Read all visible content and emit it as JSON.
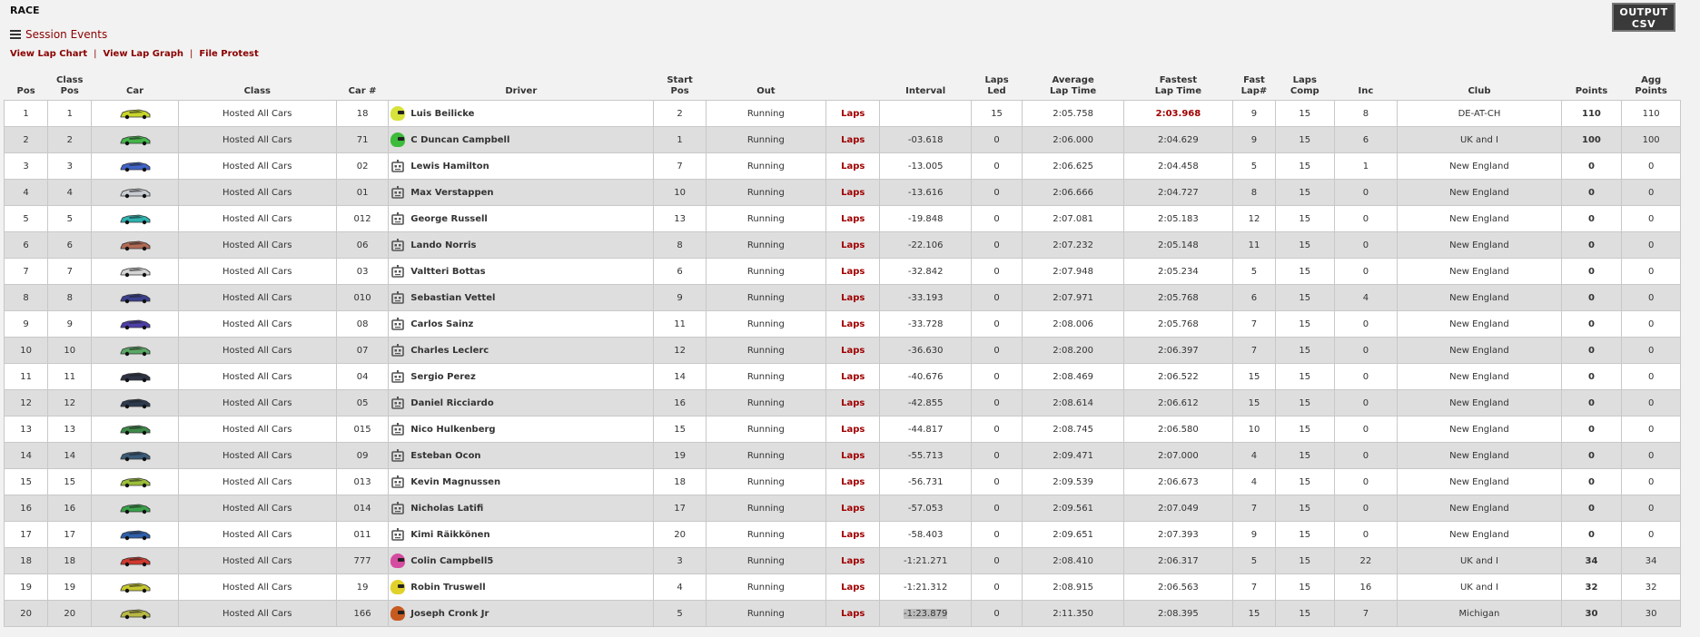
{
  "header": {
    "race_title": "RACE",
    "session_events": "Session Events",
    "links": [
      "View Lap Chart",
      "View Lap Graph",
      "File Protest"
    ],
    "output_csv": [
      "OUTPUT",
      "CSV"
    ]
  },
  "columns": [
    "Pos",
    "Class Pos",
    "Car",
    "Class",
    "Car #",
    "Driver",
    "Start Pos",
    "Out",
    "",
    "Interval",
    "Laps Led",
    "Average Lap Time",
    "Fastest Lap Time",
    "Fast Lap#",
    "Laps Comp",
    "Inc",
    "Club",
    "Points",
    "Agg Points"
  ],
  "column_headers": {
    "pos": "Pos",
    "class_pos": "Class Pos",
    "car": "Car",
    "class": "Class",
    "car_num": "Car #",
    "driver": "Driver",
    "start_pos_1": "Start",
    "start_pos_2": "Pos",
    "out": "Out",
    "interval": "Interval",
    "laps_led_1": "Laps",
    "laps_led_2": "Led",
    "avg_1": "Average",
    "avg_2": "Lap Time",
    "fast_1": "Fastest",
    "fast_2": "Lap Time",
    "fastnum_1": "Fast",
    "fastnum_2": "Lap#",
    "lapscomp_1": "Laps",
    "lapscomp_2": "Comp",
    "inc": "Inc",
    "club": "Club",
    "points": "Points",
    "agg_1": "Agg",
    "agg_2": "Points"
  },
  "laps_link_label": "Laps",
  "rows": [
    {
      "pos": "1",
      "class_pos": "1",
      "car_color": "#c9d62a",
      "class": "Hosted All Cars",
      "car_num": "18",
      "driver": "Luis Beilicke",
      "helmet": "#d7e23a",
      "start": "2",
      "out": "Running",
      "interval": "",
      "laps_led": "15",
      "avg": "2:05.758",
      "fast": "2:03.968",
      "fast_red": true,
      "fast_lap": "9",
      "laps_comp": "15",
      "inc": "8",
      "club": "DE-AT-CH",
      "points": "110",
      "agg": "110"
    },
    {
      "pos": "2",
      "class_pos": "2",
      "car_color": "#45b54a",
      "class": "Hosted All Cars",
      "car_num": "71",
      "driver": "C Duncan Campbell",
      "helmet": "#3dbb3a",
      "start": "1",
      "out": "Running",
      "interval": "-03.618",
      "laps_led": "0",
      "avg": "2:06.000",
      "fast": "2:04.629",
      "fast_lap": "9",
      "laps_comp": "15",
      "inc": "6",
      "club": "UK and I",
      "points": "100",
      "agg": "100"
    },
    {
      "pos": "3",
      "class_pos": "3",
      "car_color": "#3f63c7",
      "class": "Hosted All Cars",
      "car_num": "02",
      "driver": "Lewis Hamilton",
      "start": "7",
      "out": "Running",
      "interval": "-13.005",
      "laps_led": "0",
      "avg": "2:06.625",
      "fast": "2:04.458",
      "fast_lap": "5",
      "laps_comp": "15",
      "inc": "1",
      "club": "New England",
      "points": "0",
      "agg": "0"
    },
    {
      "pos": "4",
      "class_pos": "4",
      "car_color": "#c9cdd3",
      "class": "Hosted All Cars",
      "car_num": "01",
      "driver": "Max Verstappen",
      "start": "10",
      "out": "Running",
      "interval": "-13.616",
      "laps_led": "0",
      "avg": "2:06.666",
      "fast": "2:04.727",
      "fast_lap": "8",
      "laps_comp": "15",
      "inc": "0",
      "club": "New England",
      "points": "0",
      "agg": "0"
    },
    {
      "pos": "5",
      "class_pos": "5",
      "car_color": "#2eb3b0",
      "class": "Hosted All Cars",
      "car_num": "012",
      "driver": "George Russell",
      "start": "13",
      "out": "Running",
      "interval": "-19.848",
      "laps_led": "0",
      "avg": "2:07.081",
      "fast": "2:05.183",
      "fast_lap": "12",
      "laps_comp": "15",
      "inc": "0",
      "club": "New England",
      "points": "0",
      "agg": "0"
    },
    {
      "pos": "6",
      "class_pos": "6",
      "car_color": "#b06a55",
      "class": "Hosted All Cars",
      "car_num": "06",
      "driver": "Lando Norris",
      "start": "8",
      "out": "Running",
      "interval": "-22.106",
      "laps_led": "0",
      "avg": "2:07.232",
      "fast": "2:05.148",
      "fast_lap": "11",
      "laps_comp": "15",
      "inc": "0",
      "club": "New England",
      "points": "0",
      "agg": "0"
    },
    {
      "pos": "7",
      "class_pos": "7",
      "car_color": "#d4d4d4",
      "class": "Hosted All Cars",
      "car_num": "03",
      "driver": "Valtteri Bottas",
      "start": "6",
      "out": "Running",
      "interval": "-32.842",
      "laps_led": "0",
      "avg": "2:07.948",
      "fast": "2:05.234",
      "fast_lap": "5",
      "laps_comp": "15",
      "inc": "0",
      "club": "New England",
      "points": "0",
      "agg": "0"
    },
    {
      "pos": "8",
      "class_pos": "8",
      "car_color": "#3a3f8c",
      "class": "Hosted All Cars",
      "car_num": "010",
      "driver": "Sebastian Vettel",
      "start": "9",
      "out": "Running",
      "interval": "-33.193",
      "laps_led": "0",
      "avg": "2:07.971",
      "fast": "2:05.768",
      "fast_lap": "6",
      "laps_comp": "15",
      "inc": "4",
      "club": "New England",
      "points": "0",
      "agg": "0"
    },
    {
      "pos": "9",
      "class_pos": "9",
      "car_color": "#4d3fa8",
      "class": "Hosted All Cars",
      "car_num": "08",
      "driver": "Carlos Sainz",
      "start": "11",
      "out": "Running",
      "interval": "-33.728",
      "laps_led": "0",
      "avg": "2:08.006",
      "fast": "2:05.768",
      "fast_lap": "7",
      "laps_comp": "15",
      "inc": "0",
      "club": "New England",
      "points": "0",
      "agg": "0"
    },
    {
      "pos": "10",
      "class_pos": "10",
      "car_color": "#5aa865",
      "class": "Hosted All Cars",
      "car_num": "07",
      "driver": "Charles Leclerc",
      "start": "12",
      "out": "Running",
      "interval": "-36.630",
      "laps_led": "0",
      "avg": "2:08.200",
      "fast": "2:06.397",
      "fast_lap": "7",
      "laps_comp": "15",
      "inc": "0",
      "club": "New England",
      "points": "0",
      "agg": "0"
    },
    {
      "pos": "11",
      "class_pos": "11",
      "car_color": "#2e3444",
      "class": "Hosted All Cars",
      "car_num": "04",
      "driver": "Sergio Perez",
      "start": "14",
      "out": "Running",
      "interval": "-40.676",
      "laps_led": "0",
      "avg": "2:08.469",
      "fast": "2:06.522",
      "fast_lap": "15",
      "laps_comp": "15",
      "inc": "0",
      "club": "New England",
      "points": "0",
      "agg": "0"
    },
    {
      "pos": "12",
      "class_pos": "12",
      "car_color": "#2d3a4e",
      "class": "Hosted All Cars",
      "car_num": "05",
      "driver": "Daniel Ricciardo",
      "start": "16",
      "out": "Running",
      "interval": "-42.855",
      "laps_led": "0",
      "avg": "2:08.614",
      "fast": "2:06.612",
      "fast_lap": "15",
      "laps_comp": "15",
      "inc": "0",
      "club": "New England",
      "points": "0",
      "agg": "0"
    },
    {
      "pos": "13",
      "class_pos": "13",
      "car_color": "#3f8a4a",
      "class": "Hosted All Cars",
      "car_num": "015",
      "driver": "Nico Hulkenberg",
      "start": "15",
      "out": "Running",
      "interval": "-44.817",
      "laps_led": "0",
      "avg": "2:08.745",
      "fast": "2:06.580",
      "fast_lap": "10",
      "laps_comp": "15",
      "inc": "0",
      "club": "New England",
      "points": "0",
      "agg": "0"
    },
    {
      "pos": "14",
      "class_pos": "14",
      "car_color": "#3b5a78",
      "class": "Hosted All Cars",
      "car_num": "09",
      "driver": "Esteban Ocon",
      "start": "19",
      "out": "Running",
      "interval": "-55.713",
      "laps_led": "0",
      "avg": "2:09.471",
      "fast": "2:07.000",
      "fast_lap": "4",
      "laps_comp": "15",
      "inc": "0",
      "club": "New England",
      "points": "0",
      "agg": "0"
    },
    {
      "pos": "15",
      "class_pos": "15",
      "car_color": "#9bbf3a",
      "class": "Hosted All Cars",
      "car_num": "013",
      "driver": "Kevin Magnussen",
      "start": "18",
      "out": "Running",
      "interval": "-56.731",
      "laps_led": "0",
      "avg": "2:09.539",
      "fast": "2:06.673",
      "fast_lap": "4",
      "laps_comp": "15",
      "inc": "0",
      "club": "New England",
      "points": "0",
      "agg": "0"
    },
    {
      "pos": "16",
      "class_pos": "16",
      "car_color": "#3aa24a",
      "class": "Hosted All Cars",
      "car_num": "014",
      "driver": "Nicholas Latifi",
      "start": "17",
      "out": "Running",
      "interval": "-57.053",
      "laps_led": "0",
      "avg": "2:09.561",
      "fast": "2:07.049",
      "fast_lap": "7",
      "laps_comp": "15",
      "inc": "0",
      "club": "New England",
      "points": "0",
      "agg": "0"
    },
    {
      "pos": "17",
      "class_pos": "17",
      "car_color": "#2f5fa8",
      "class": "Hosted All Cars",
      "car_num": "011",
      "driver": "Kimi Räikkönen",
      "start": "20",
      "out": "Running",
      "interval": "-58.403",
      "laps_led": "0",
      "avg": "2:09.651",
      "fast": "2:07.393",
      "fast_lap": "9",
      "laps_comp": "15",
      "inc": "0",
      "club": "New England",
      "points": "0",
      "agg": "0"
    },
    {
      "pos": "18",
      "class_pos": "18",
      "car_color": "#d03a2e",
      "class": "Hosted All Cars",
      "car_num": "777",
      "driver": "Colin Campbell5",
      "helmet": "#d44ba0",
      "start": "3",
      "out": "Running",
      "interval": "-1:21.271",
      "laps_led": "0",
      "avg": "2:08.410",
      "fast": "2:06.317",
      "fast_lap": "5",
      "laps_comp": "15",
      "inc": "22",
      "club": "UK and I",
      "points": "34",
      "agg": "34"
    },
    {
      "pos": "19",
      "class_pos": "19",
      "car_color": "#c7c832",
      "class": "Hosted All Cars",
      "car_num": "19",
      "driver": "Robin Truswell",
      "helmet": "#e0d22a",
      "start": "4",
      "out": "Running",
      "interval": "-1:21.312",
      "laps_led": "0",
      "avg": "2:08.915",
      "fast": "2:06.563",
      "fast_lap": "7",
      "laps_comp": "15",
      "inc": "16",
      "club": "UK and I",
      "points": "32",
      "agg": "32"
    },
    {
      "pos": "20",
      "class_pos": "20",
      "car_color": "#b8b845",
      "class": "Hosted All Cars",
      "car_num": "166",
      "driver": "Joseph Cronk Jr",
      "helmet": "#c75a1f",
      "start": "5",
      "out": "Running",
      "interval": "-1:23.879",
      "interval_hl": true,
      "laps_led": "0",
      "avg": "2:11.350",
      "fast": "2:08.395",
      "fast_lap": "15",
      "laps_comp": "15",
      "inc": "7",
      "club": "Michigan",
      "points": "30",
      "agg": "30"
    }
  ]
}
